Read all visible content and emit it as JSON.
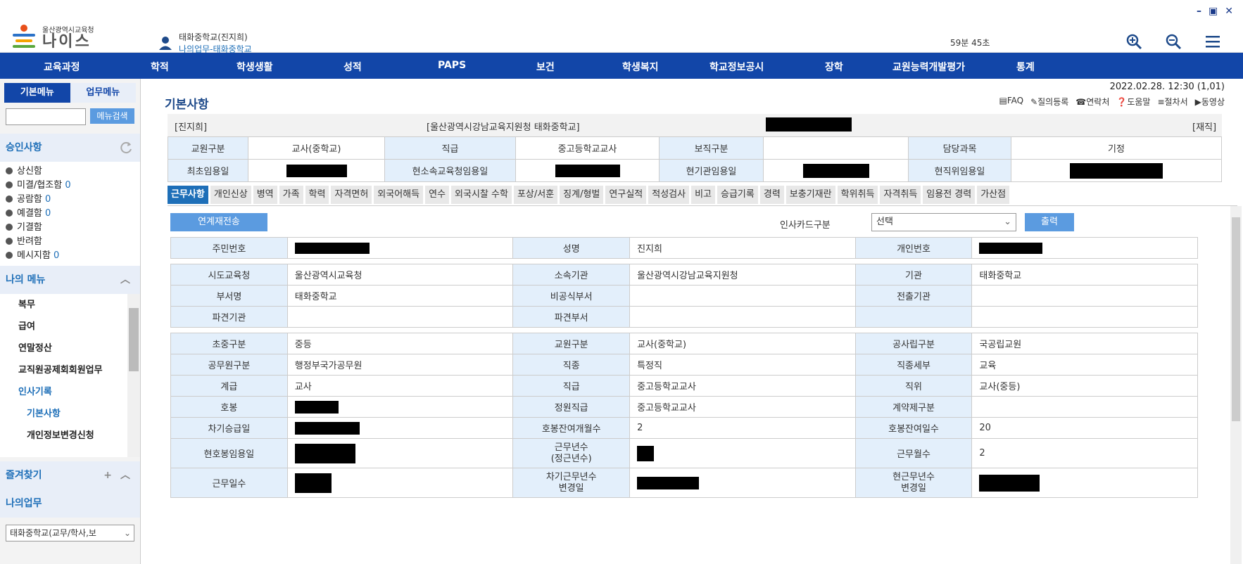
{
  "window": {
    "min": "–",
    "max": "▣",
    "close": "✕"
  },
  "logo": {
    "org": "울산광역시교육청",
    "name": "나이스"
  },
  "user": {
    "line1": "태화중학교(진지희)",
    "line2": "나의업무-태화중학교"
  },
  "timer": "59분 45초",
  "nav": [
    "교육과정",
    "학적",
    "학생생활",
    "성적",
    "PAPS",
    "보건",
    "학생복지",
    "학교정보공시",
    "장학",
    "교원능력개발평가",
    "통계"
  ],
  "left": {
    "tabs": [
      "기본메뉴",
      "업무메뉴"
    ],
    "search_btn": "메뉴검색",
    "approve_title": "승인사항",
    "approve": [
      {
        "label": "상신함",
        "count": ""
      },
      {
        "label": "미결/협조함",
        "count": "0"
      },
      {
        "label": "공람함",
        "count": "0"
      },
      {
        "label": "예결함",
        "count": "0"
      },
      {
        "label": "기결함",
        "count": ""
      },
      {
        "label": "반려함",
        "count": ""
      },
      {
        "label": "메시지함",
        "count": "0"
      }
    ],
    "mymenu_title": "나의 메뉴",
    "mymenu": [
      "복무",
      "급여",
      "연말정산",
      "교직원공제회회원업무",
      "인사기록",
      "기본사항",
      "개인정보변경신청"
    ],
    "fav_title": "즐겨찾기",
    "mywork_title": "나의업무",
    "select": "태화중학교(교무/학사,보"
  },
  "main": {
    "date": "2022.02.28. 12:30 (1,01)",
    "title": "기본사항",
    "links": [
      "FAQ",
      "질의등록",
      "연락처",
      "도움말",
      "절차서",
      "동영상"
    ],
    "header": {
      "name": "[진지희]",
      "org": "[울산광역시강남교육지원청 태화중학교]",
      "status": "[재직]"
    },
    "row1": {
      "l1": "교원구분",
      "v1": "교사(중학교)",
      "l2": "직급",
      "v2": "중고등학교교사",
      "l3": "보직구분",
      "v3": "",
      "l4": "담당과목",
      "v4": "기정"
    },
    "row2": {
      "l1": "최초임용일",
      "l2": "현소속교육청임용일",
      "l3": "현기관임용일",
      "l4": "현직위임용일"
    },
    "tabs": [
      "근무사항",
      "개인신상",
      "병역",
      "가족",
      "학력",
      "자격면허",
      "외국어해득",
      "연수",
      "외국시찰 수학",
      "포상/서훈",
      "징계/형벌",
      "연구실적",
      "적성검사",
      "비고",
      "승급기록",
      "경력",
      "보충기재란",
      "학위취득",
      "자격취득",
      "임용전 경력",
      "가산점"
    ],
    "btn_resend": "연계재전송",
    "card_label": "인사카드구분",
    "card_select": "선택",
    "btn_print": "출력",
    "g1": [
      {
        "l": "주민번호",
        "v": "",
        "r": true
      },
      {
        "l": "성명",
        "v": "진지희"
      },
      {
        "l": "개인번호",
        "v": "",
        "r": true
      }
    ],
    "g2": [
      [
        {
          "l": "시도교육청",
          "v": "울산광역시교육청"
        },
        {
          "l": "소속기관",
          "v": "울산광역시강남교육지원청"
        },
        {
          "l": "기관",
          "v": "태화중학교"
        }
      ],
      [
        {
          "l": "부서명",
          "v": "태화중학교"
        },
        {
          "l": "비공식부서",
          "v": ""
        },
        {
          "l": "전출기관",
          "v": ""
        }
      ],
      [
        {
          "l": "파견기관",
          "v": ""
        },
        {
          "l": "파견부서",
          "v": ""
        },
        {
          "l": "",
          "v": ""
        }
      ]
    ],
    "g3": [
      [
        {
          "l": "초중구분",
          "v": "중등"
        },
        {
          "l": "교원구분",
          "v": "교사(중학교)"
        },
        {
          "l": "공사립구분",
          "v": "국공립교원"
        }
      ],
      [
        {
          "l": "공무원구분",
          "v": "행정부국가공무원"
        },
        {
          "l": "직종",
          "v": "특정직"
        },
        {
          "l": "직종세부",
          "v": "교육"
        }
      ],
      [
        {
          "l": "계급",
          "v": "교사"
        },
        {
          "l": "직급",
          "v": "중고등학교교사"
        },
        {
          "l": "직위",
          "v": "교사(중등)"
        }
      ],
      [
        {
          "l": "호봉",
          "v": "",
          "r": true
        },
        {
          "l": "정원직급",
          "v": "중고등학교교사"
        },
        {
          "l": "계약제구분",
          "v": ""
        }
      ],
      [
        {
          "l": "차기승급일",
          "v": "",
          "r": true
        },
        {
          "l": "호봉잔여개월수",
          "v": "2"
        },
        {
          "l": "호봉잔여일수",
          "v": "20"
        }
      ],
      [
        {
          "l": "현호봉임용일",
          "v": "",
          "r": true
        },
        {
          "l": "근무년수\n(정근년수)",
          "v": "",
          "r": true
        },
        {
          "l": "근무월수",
          "v": "2"
        }
      ],
      [
        {
          "l": "근무일수",
          "v": "",
          "r": true
        },
        {
          "l": "차기근무년수\n변경일",
          "v": "",
          "r": true
        },
        {
          "l": "현근무년수\n변경일",
          "v": "",
          "r": true
        }
      ]
    ]
  }
}
